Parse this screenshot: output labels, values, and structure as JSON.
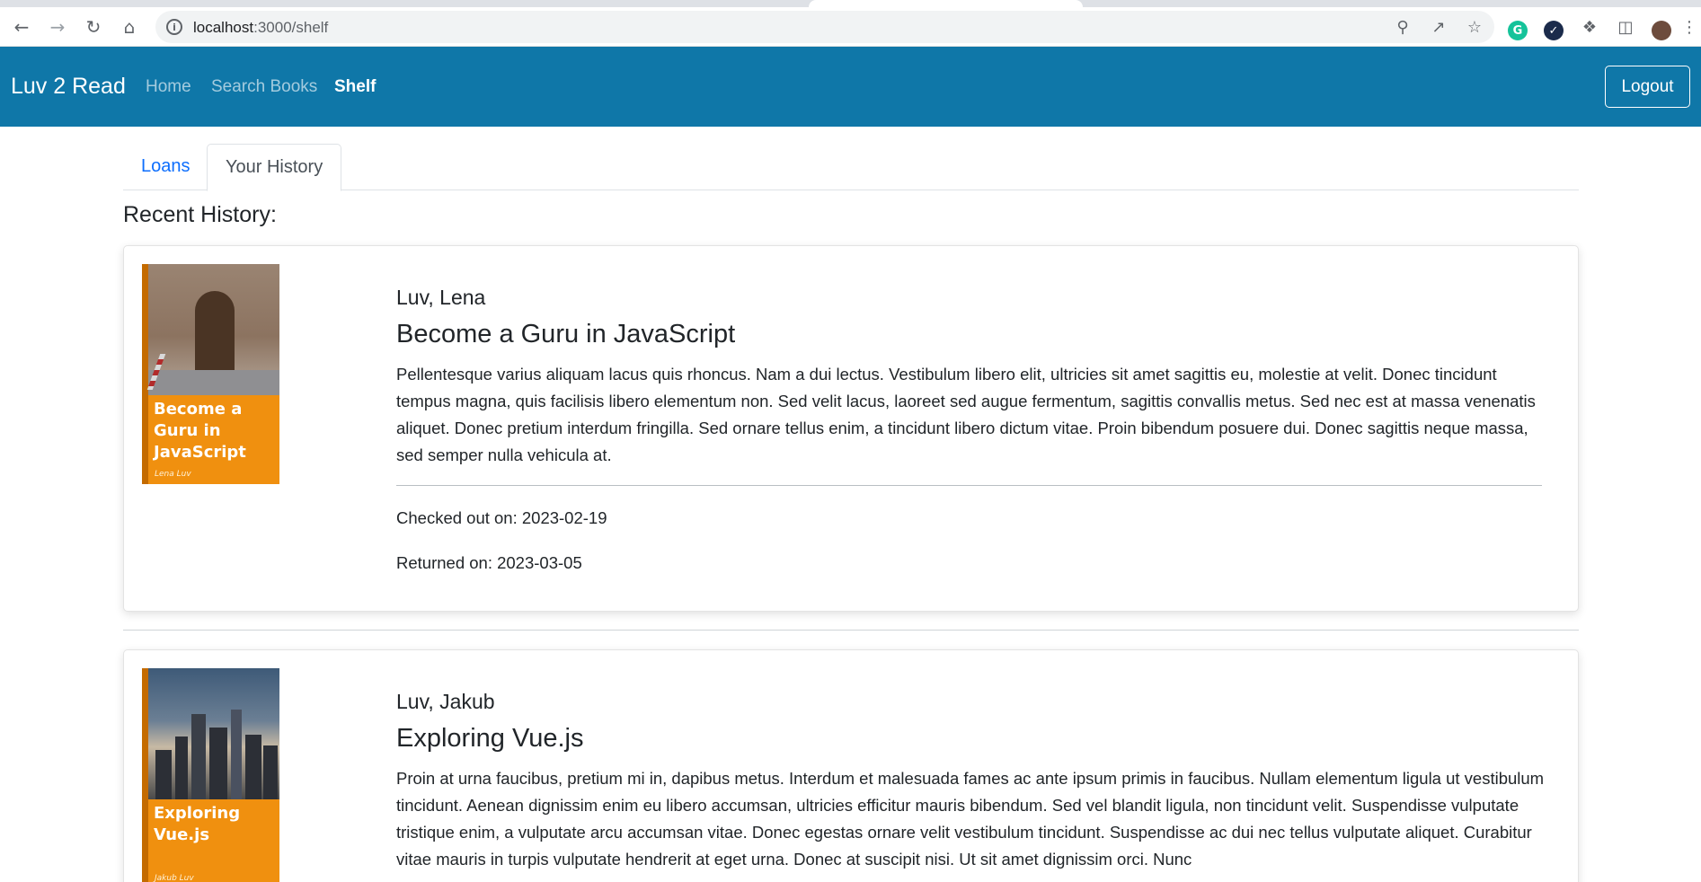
{
  "browser": {
    "url_host": "localhost",
    "url_path": ":3000/shelf",
    "icons": {
      "back": "back-arrow-icon",
      "forward": "forward-arrow-icon",
      "reload": "reload-icon",
      "home": "home-icon",
      "site_info": "info-icon",
      "key": "key-icon",
      "share": "share-icon",
      "bookmark": "star-icon",
      "grammarly": "grammarly-icon",
      "extension_check": "check-icon",
      "extensions": "puzzle-icon",
      "side_panel": "side-panel-icon",
      "profile": "avatar-icon",
      "menu": "kebab-menu-icon"
    }
  },
  "navbar": {
    "brand": "Luv 2 Read",
    "links": [
      {
        "label": "Home",
        "active": false
      },
      {
        "label": "Search Books",
        "active": false
      },
      {
        "label": "Shelf",
        "active": true
      }
    ],
    "logout_label": "Logout",
    "background_color": "#0f77a8"
  },
  "tabs": [
    {
      "label": "Loans",
      "active": false
    },
    {
      "label": "Your History",
      "active": true
    }
  ],
  "section_title": "Recent History:",
  "history": [
    {
      "cover_title": "Become a Guru in JavaScript",
      "cover_author": "Lena Luv",
      "author": "Luv, Lena",
      "title": "Become a Guru in JavaScript",
      "description": "Pellentesque varius aliquam lacus quis rhoncus. Nam a dui lectus. Vestibulum libero elit, ultricies sit amet sagittis eu, molestie at velit. Donec tincidunt tempus magna, quis facilisis libero elementum non. Sed velit lacus, laoreet sed augue fermentum, sagittis convallis metus. Sed nec est at massa venenatis aliquet. Donec pretium interdum fringilla. Sed ornare tellus enim, a tincidunt libero dictum vitae. Proin bibendum posuere dui. Donec sagittis neque massa, sed semper nulla vehicula at.",
      "checked_out": "Checked out on: 2023-02-19",
      "returned": "Returned on: 2023-03-05"
    },
    {
      "cover_title": "Exploring Vue.js",
      "cover_author": "Jakub Luv",
      "author": "Luv, Jakub",
      "title": "Exploring Vue.js",
      "description": "Proin at urna faucibus, pretium mi in, dapibus metus. Interdum et malesuada fames ac ante ipsum primis in faucibus. Nullam elementum ligula ut vestibulum tincidunt. Aenean dignissim enim eu libero accumsan, ultricies efficitur mauris bibendum. Sed vel blandit ligula, non tincidunt velit. Suspendisse vulputate tristique enim, a vulputate arcu accumsan vitae. Donec egestas ornare velit vestibulum tincidunt. Suspendisse ac dui nec tellus vulputate aliquet. Curabitur vitae mauris in turpis vulputate hendrerit at eget urna. Donec at suscipit nisi. Ut sit amet dignissim orci. Nunc"
    }
  ]
}
